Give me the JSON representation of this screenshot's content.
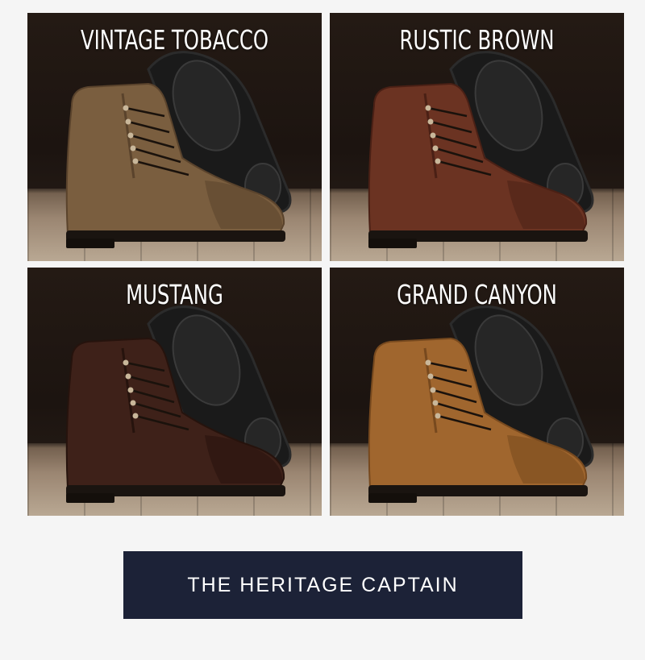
{
  "variants": [
    {
      "label": "VINTAGE TOBACCO",
      "upper_color": "#7a5e3f",
      "upper_shade": "#5a432c",
      "sole_color": "#1a1a1a"
    },
    {
      "label": "RUSTIC BROWN",
      "upper_color": "#6b3322",
      "upper_shade": "#4a2015",
      "sole_color": "#1a1a1a"
    },
    {
      "label": "MUSTANG",
      "upper_color": "#3e2119",
      "upper_shade": "#26130d",
      "sole_color": "#1a1a1a"
    },
    {
      "label": "GRAND CANYON",
      "upper_color": "#a0662e",
      "upper_shade": "#77491e",
      "sole_color": "#1a1a1a"
    }
  ],
  "cta": {
    "label": "THE HERITAGE CAPTAIN",
    "background": "#1c2237"
  }
}
